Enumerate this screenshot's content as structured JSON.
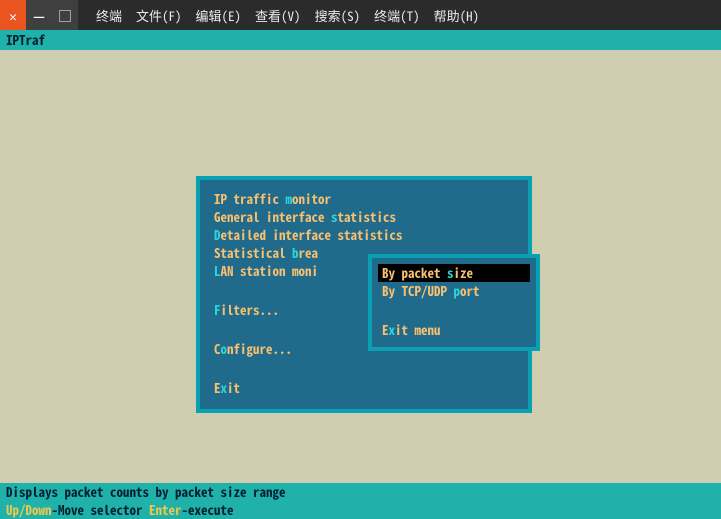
{
  "window": {
    "close": "✕",
    "min": "—",
    "max": "▢"
  },
  "menubar": {
    "terminal": "终端",
    "file": "文件(F)",
    "edit": "编辑(E)",
    "view": "查看(V)",
    "search": "搜索(S)",
    "terminal2": "终端(T)",
    "help": "帮助(H)"
  },
  "app": {
    "title": "IPTraf"
  },
  "main_menu": {
    "items": {
      "ip_monitor_pre": "IP traffic ",
      "ip_monitor_hot": "m",
      "ip_monitor_post": "onitor",
      "gen_if_pre": "General interface ",
      "gen_if_hot": "s",
      "gen_if_post": "tatistics",
      "det_if_hot": "D",
      "det_if_post": "etailed interface statistics",
      "stat_brk_pre": "Statistical ",
      "stat_brk_hot": "b",
      "stat_brk_post": "rea",
      "lan_hot": "L",
      "lan_post": "AN station moni",
      "filters_hot": "F",
      "filters_post": "ilters...",
      "config_pre": "C",
      "config_hot": "o",
      "config_post": "nfigure...",
      "exit_pre": "E",
      "exit_hot": "x",
      "exit_post": "it"
    }
  },
  "sub_menu": {
    "by_size_pre": "By packet ",
    "by_size_hot": "s",
    "by_size_post": "ize",
    "by_port_pre": "By TCP/UDP ",
    "by_port_hot": "p",
    "by_port_post": "ort",
    "exit_pre": "E",
    "exit_hot": "x",
    "exit_post": "it menu"
  },
  "status": {
    "line1": "Displays packet counts by packet size range",
    "updown": "Up/Down",
    "updown_desc": "-Move selector  ",
    "enter": "Enter",
    "enter_desc": "-execute"
  }
}
